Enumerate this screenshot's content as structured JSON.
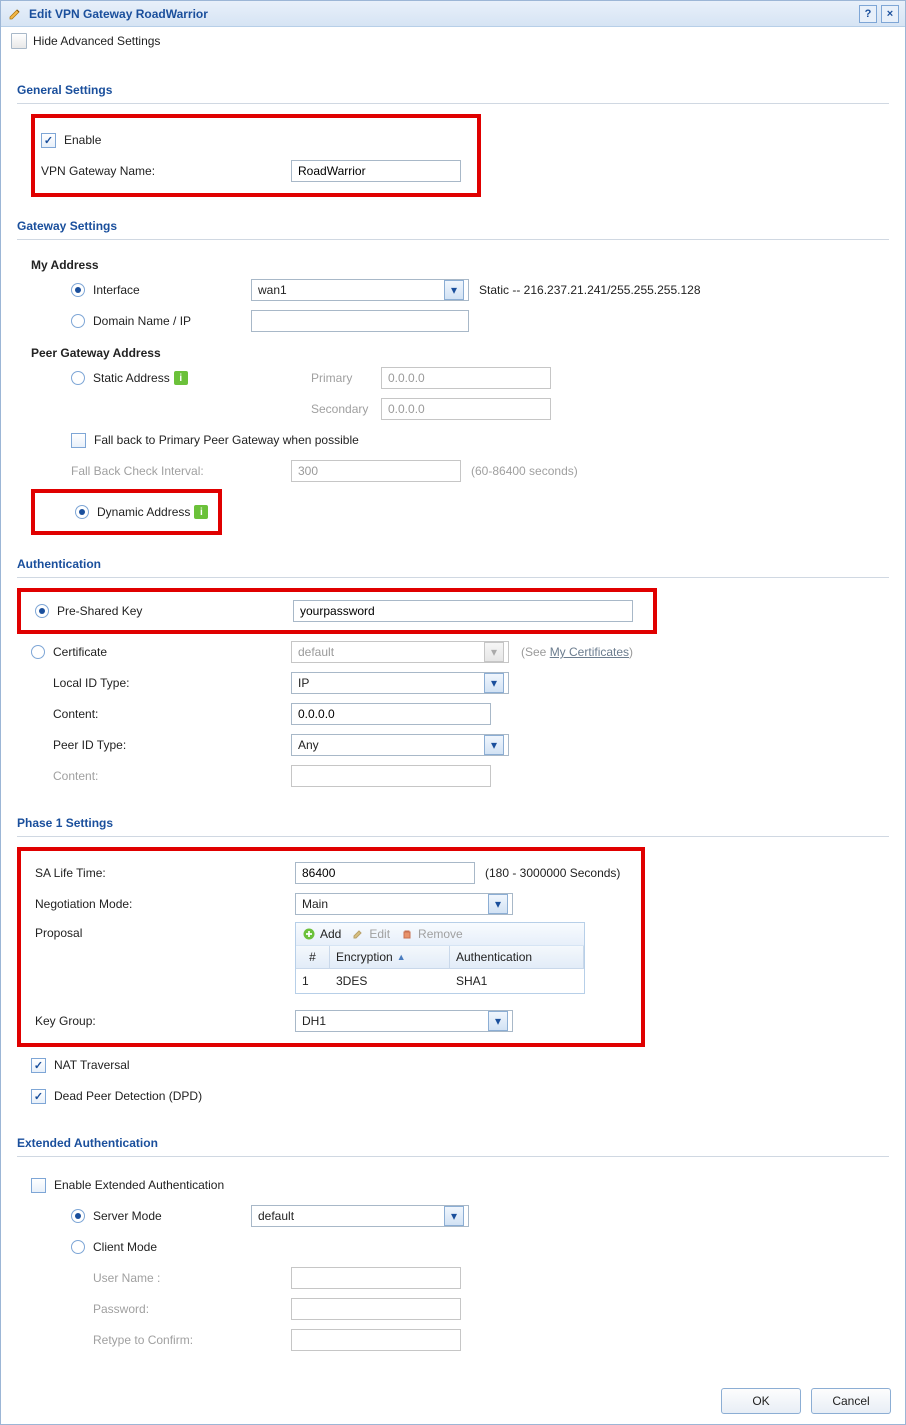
{
  "window": {
    "title": "Edit VPN Gateway RoadWarrior",
    "help_char": "?",
    "close_char": "×"
  },
  "toolbar": {
    "toggle_advanced": "Hide Advanced Settings"
  },
  "sections": {
    "general": {
      "heading": "General Settings",
      "enable_label": "Enable",
      "name_label": "VPN Gateway Name:",
      "name_value": "RoadWarrior"
    },
    "gateway": {
      "heading": "Gateway Settings",
      "my_address_heading": "My Address",
      "interface_label": "Interface",
      "interface_value": "wan1",
      "interface_static_info": "Static -- 216.237.21.241/255.255.255.128",
      "domain_label": "Domain Name / IP",
      "domain_value": "",
      "peer_heading": "Peer Gateway Address",
      "static_label": "Static Address",
      "primary_label": "Primary",
      "primary_value": "0.0.0.0",
      "secondary_label": "Secondary",
      "secondary_value": "0.0.0.0",
      "fallback_label": "Fall back to Primary Peer Gateway when possible",
      "fallback_interval_label": "Fall Back Check Interval:",
      "fallback_interval_value": "300",
      "fallback_interval_hint": "(60-86400 seconds)",
      "dynamic_label": "Dynamic Address"
    },
    "auth": {
      "heading": "Authentication",
      "psk_label": "Pre-Shared Key",
      "psk_value": "yourpassword",
      "cert_label": "Certificate",
      "cert_value": "default",
      "cert_hint_prefix": "(See ",
      "cert_link": "My Certificates",
      "cert_hint_suffix": ")",
      "local_id_type_label": "Local ID Type:",
      "local_id_type_value": "IP",
      "content_label": "Content:",
      "content_value": "0.0.0.0",
      "peer_id_type_label": "Peer ID Type:",
      "peer_id_type_value": "Any",
      "content2_label": "Content:",
      "content2_value": ""
    },
    "phase1": {
      "heading": "Phase 1 Settings",
      "sa_life_label": "SA Life Time:",
      "sa_life_value": "86400",
      "sa_life_hint": "(180 - 3000000 Seconds)",
      "negmode_label": "Negotiation Mode:",
      "negmode_value": "Main",
      "proposal_label": "Proposal",
      "add_label": "Add",
      "edit_label": "Edit",
      "remove_label": "Remove",
      "grid": {
        "col_num": "#",
        "col_enc": "Encryption",
        "col_auth": "Authentication",
        "rows": [
          {
            "num": "1",
            "enc": "3DES",
            "auth": "SHA1"
          }
        ]
      },
      "keygroup_label": "Key Group:",
      "keygroup_value": "DH1",
      "nat_label": "NAT Traversal",
      "dpd_label": "Dead Peer Detection (DPD)"
    },
    "extauth": {
      "heading": "Extended Authentication",
      "enable_label": "Enable Extended Authentication",
      "server_label": "Server Mode",
      "server_value": "default",
      "client_label": "Client Mode",
      "username_label": "User Name :",
      "password_label": "Password:",
      "retype_label": "Retype to Confirm:"
    }
  },
  "footer": {
    "ok": "OK",
    "cancel": "Cancel"
  },
  "icons": {
    "info": "i"
  }
}
